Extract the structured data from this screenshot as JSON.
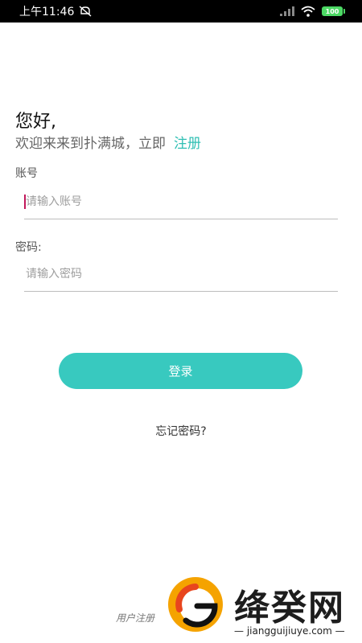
{
  "status_bar": {
    "time": "上午11:46",
    "battery": "100"
  },
  "login": {
    "greeting": "您好,",
    "welcome": "欢迎来来到扑满城，立即",
    "register_link": "注册",
    "account_label": "账号",
    "account_placeholder": "请输入账号",
    "password_label": "密码:",
    "password_placeholder": "请输入密码",
    "login_button": "登录",
    "forgot_password": "忘记密码?",
    "bottom_register": "用户注册"
  },
  "watermark": {
    "text": "绛癸网",
    "url": "—  jiangguijiuye.com  —"
  },
  "colors": {
    "accent": "#38c9bf",
    "link": "#2fbfb3",
    "caret": "#c2185b"
  }
}
